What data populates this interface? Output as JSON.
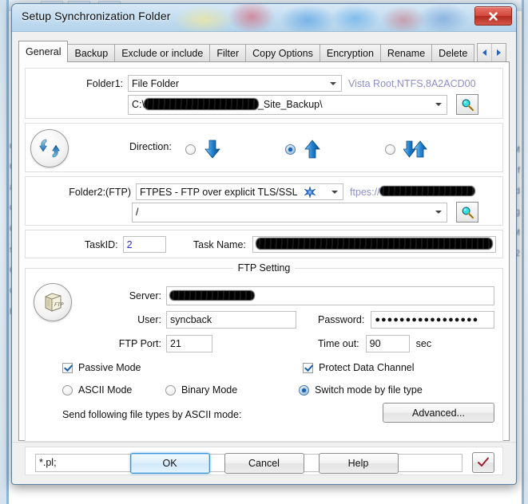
{
  "window": {
    "title": "Setup Synchronization Folder",
    "close_label": "✕"
  },
  "tabs": {
    "items": [
      {
        "label": "General",
        "active": true
      },
      {
        "label": "Backup",
        "active": false
      },
      {
        "label": "Exclude or include",
        "active": false
      },
      {
        "label": "Filter",
        "active": false
      },
      {
        "label": "Copy Options",
        "active": false
      },
      {
        "label": "Encryption",
        "active": false
      },
      {
        "label": "Rename",
        "active": false
      },
      {
        "label": "Delete",
        "active": false
      }
    ],
    "scroll_left": "◀",
    "scroll_right": "▶"
  },
  "folder1": {
    "label": "Folder1:",
    "type_value": "File Folder",
    "volume_info": "Vista Root,NTFS,8A2ACD00",
    "path_prefix": "C:\\",
    "path_suffix": "_Site_Backup\\",
    "browse_icon": "magnifier-icon"
  },
  "direction": {
    "label": "Direction:",
    "sync_icon": "sync-circular-icon",
    "options": [
      {
        "name": "download",
        "icon": "arrow-down-icon",
        "selected": false
      },
      {
        "name": "upload",
        "icon": "arrow-up-icon",
        "selected": true
      },
      {
        "name": "bidirectional",
        "icon": "arrow-up-down-icon",
        "selected": false
      }
    ]
  },
  "folder2": {
    "label": "Folder2:(FTP)",
    "protocol_value": "FTPES - FTP over explicit TLS/SSL",
    "protocol_icon": "star-burst-icon",
    "url_scheme": "ftpes://",
    "remote_path": "/",
    "browse_icon": "magnifier-icon"
  },
  "task": {
    "id_label": "TaskID:",
    "id_value": "2",
    "name_label": "Task Name:"
  },
  "ftp_setting": {
    "group_title": "FTP Setting",
    "box_icon": "ftp-box-icon",
    "server_label": "Server:",
    "user_label": "User:",
    "user_value": "syncback",
    "password_label": "Password:",
    "password_value": "●●●●●●●●●●●●●●●●●",
    "port_label": "FTP Port:",
    "port_value": "21",
    "timeout_label": "Time out:",
    "timeout_value": "90",
    "timeout_unit": "sec",
    "passive_label": "Passive Mode",
    "passive_checked": true,
    "protect_label": "Protect Data Channel",
    "protect_checked": true,
    "modes": [
      {
        "label": "ASCII Mode",
        "selected": false
      },
      {
        "label": "Binary Mode",
        "selected": false
      },
      {
        "label": "Switch mode by file type",
        "selected": true
      }
    ],
    "advanced_label": "Advanced...",
    "ascii_types_label": "Send following file types by ASCII mode:",
    "ascii_types_value": "*.pl;",
    "confirm_icon": "red-check-icon"
  },
  "buttons": {
    "ok": "OK",
    "cancel": "Cancel",
    "help": "Help"
  },
  "background": {
    "left_column": "or\nC\na:\n\nC\nC\n\ns\n\nC\nC\nH",
    "right_column": "M\n\nf\n\nd\n\ng\nM\n\n2"
  }
}
